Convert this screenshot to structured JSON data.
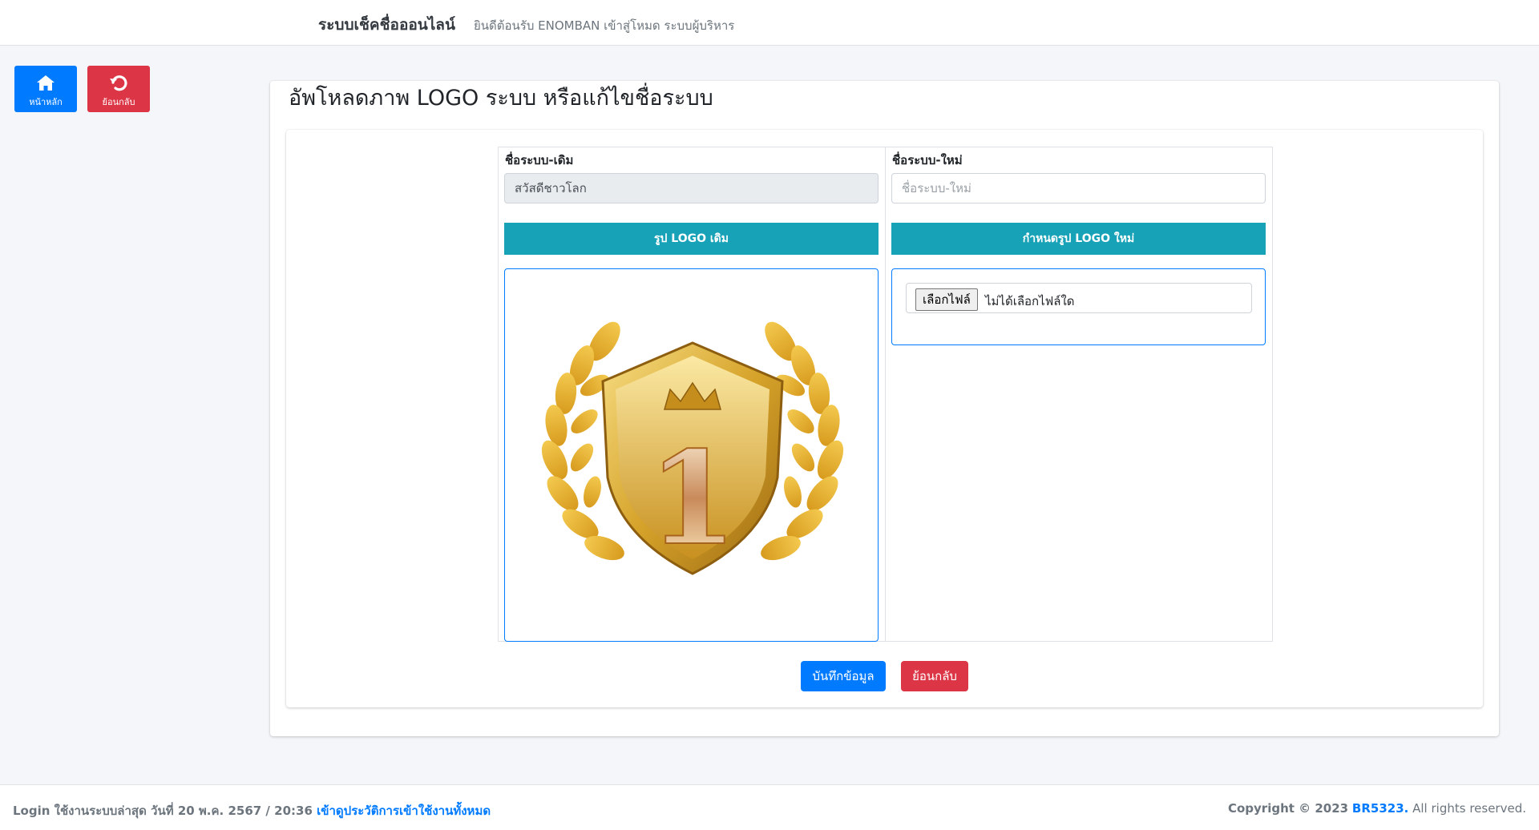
{
  "navbar": {
    "brand": "ระบบเช็คชื่อออนไลน์",
    "welcome": "ยินดีต้อนรับ ENOMBAN เข้าสู่โหมด ระบบผู้บริหาร"
  },
  "quick": {
    "home_label": "หน้าหลัก",
    "back_label": "ย้อนกลับ",
    "home_icon": "home-icon",
    "back_icon": "undo-icon"
  },
  "page": {
    "title": "อัพโหลดภาพ LOGO ระบบ หรือแก้ไขชื่อระบบ"
  },
  "form": {
    "old_name_label": "ชื่อระบบ-เดิม",
    "old_name_value": "สวัสดีชาวโลก",
    "new_name_label": "ชื่อระบบ-ใหม่",
    "new_name_placeholder": "ชื่อระบบ-ใหม่",
    "old_logo_heading": "รูป LOGO เดิม",
    "new_logo_heading": "กำหนดรูป LOGO ใหม่",
    "file_button": "เลือกไฟล์",
    "file_status": "ไม่ได้เลือกไฟล์ใด",
    "logo_number": "1",
    "save_label": "บันทึกข้อมูล",
    "cancel_label": "ย้อนกลับ"
  },
  "footer": {
    "login_text": "Login ใช้งานระบบล่าสุด วันที่ 20 พ.ค. 2567 / 20:36",
    "history_link": "เข้าดูประวัติการเข้าใช้งานทั้งหมด",
    "copyright": "Copyright © 2023",
    "company": "BR5323.",
    "rights": "All rights reserved."
  },
  "colors": {
    "primary": "#007bff",
    "danger": "#dc3545",
    "info": "#17a2b8",
    "gold": "#e2b636"
  }
}
